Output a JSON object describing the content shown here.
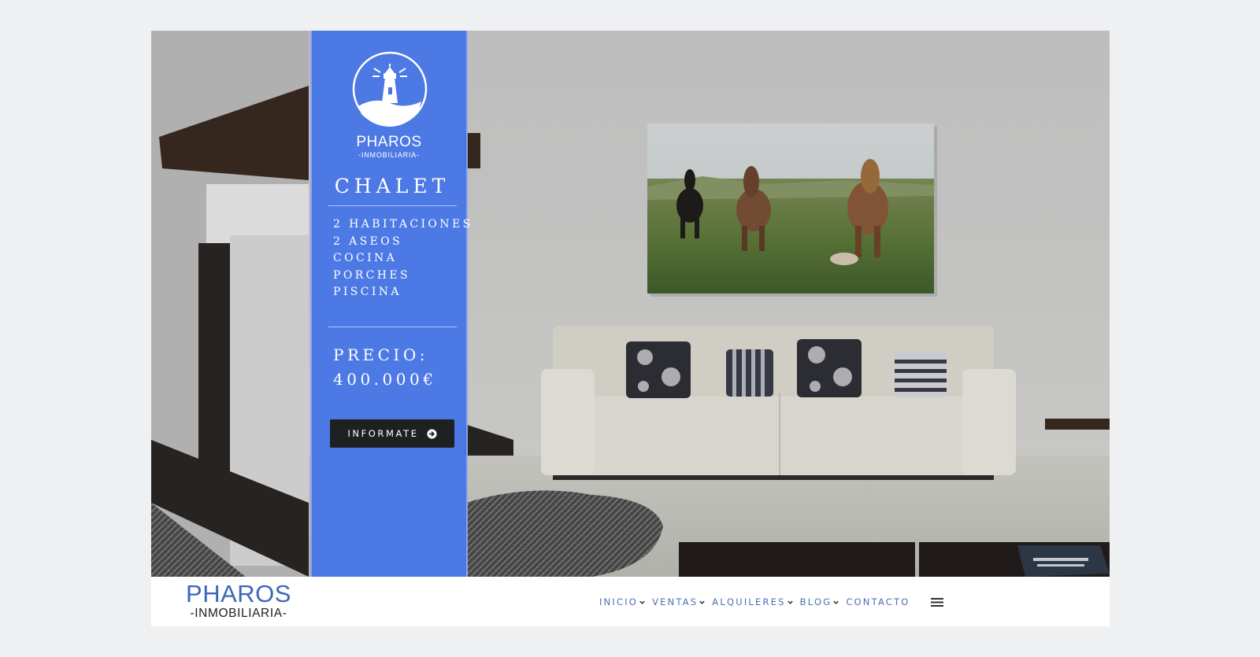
{
  "hero": {
    "panel": {
      "logo_name": "PHAROS",
      "logo_sub": "-INMOBILIARIA-",
      "title": "CHALET",
      "features": [
        "2 HABITACIONES",
        "2 ASEOS",
        "COCINA",
        "PORCHES",
        "PISCINA"
      ],
      "price_label": "PRECIO:",
      "price_value": "400.000€",
      "cta_label": "INFORMATE",
      "cta_icon": "arrow-circle-right-icon"
    },
    "colors": {
      "panel_blue": "#4876e6",
      "button_dark": "#1f2021"
    }
  },
  "navbar": {
    "brand_name": "PHAROS",
    "brand_sub": "-INMOBILIARIA-",
    "menu": [
      {
        "label": "INICIO",
        "has_dropdown": true
      },
      {
        "label": "VENTAS",
        "has_dropdown": true
      },
      {
        "label": "ALQUILERES",
        "has_dropdown": true
      },
      {
        "label": "BLOG",
        "has_dropdown": true
      },
      {
        "label": "CONTACTO",
        "has_dropdown": false
      }
    ],
    "menu_icon": "hamburger-menu-icon",
    "colors": {
      "brand_blue": "#3a68b8",
      "menu_text": "#4a6fb5"
    }
  }
}
